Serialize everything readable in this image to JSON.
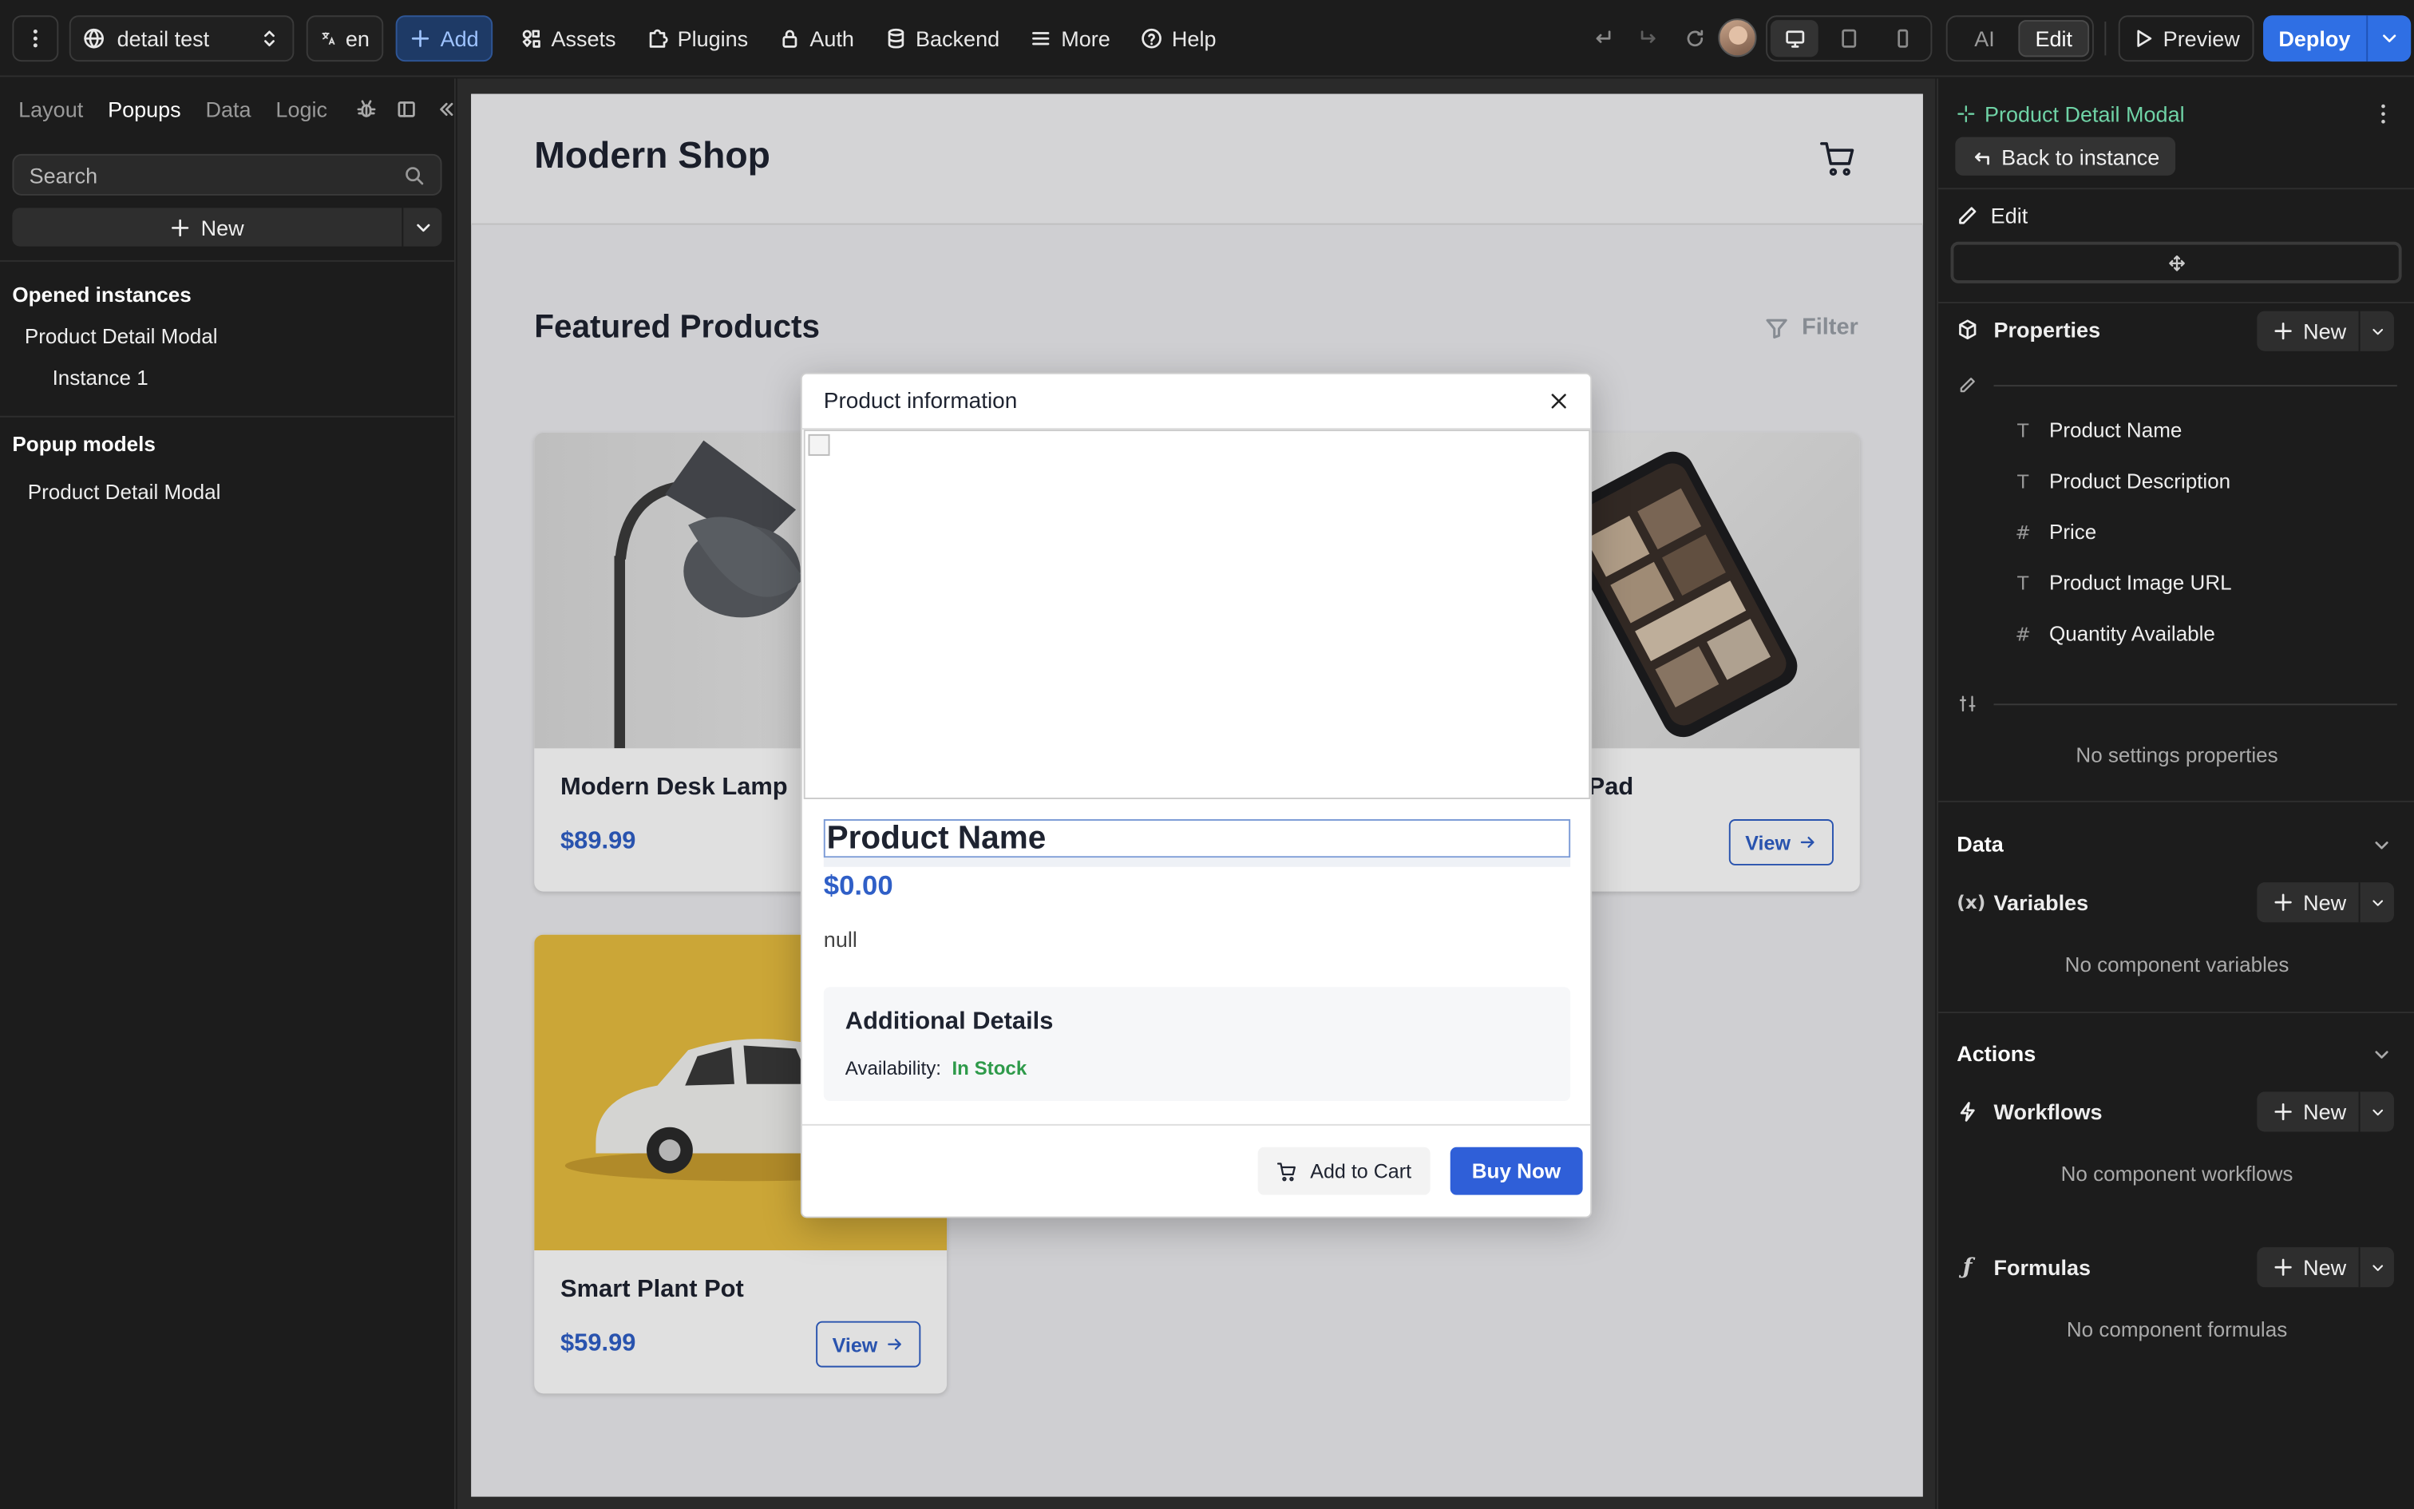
{
  "topbar": {
    "site_name": "detail test",
    "lang": "en",
    "add_label": "Add",
    "nav": [
      {
        "label": "Assets",
        "icon": "assets-icon"
      },
      {
        "label": "Plugins",
        "icon": "plugin-icon"
      },
      {
        "label": "Auth",
        "icon": "lock-icon"
      },
      {
        "label": "Backend",
        "icon": "database-icon"
      },
      {
        "label": "More",
        "icon": "menu-icon"
      },
      {
        "label": "Help",
        "icon": "help-icon"
      }
    ],
    "mode_ai": "AI",
    "mode_edit": "Edit",
    "preview_label": "Preview",
    "deploy_label": "Deploy"
  },
  "left": {
    "tabs": [
      "Layout",
      "Popups",
      "Data",
      "Logic"
    ],
    "active_tab": "Popups",
    "search_placeholder": "Search",
    "new_label": "New",
    "opened_title": "Opened instances",
    "opened_item": "Product Detail Modal",
    "opened_sub": "Instance 1",
    "models_title": "Popup models",
    "models_item": "Product Detail Modal"
  },
  "canvas": {
    "shop_title": "Modern Shop",
    "featured_title": "Featured Products",
    "filter_label": "Filter",
    "cards": [
      {
        "name": "Modern Desk Lamp",
        "price": "$89.99",
        "view": "View"
      },
      {
        "name": "Charging Pad",
        "price": "",
        "view": "View"
      },
      {
        "name": "Smart Plant Pot",
        "price": "$59.99",
        "view": "View"
      }
    ]
  },
  "modal": {
    "title": "Product information",
    "product_name": "Product Name",
    "price": "$0.00",
    "description": "null",
    "details_title": "Additional Details",
    "availability_label": "Availability:",
    "availability_value": "In Stock",
    "add_to_cart": "Add to Cart",
    "buy_now": "Buy Now"
  },
  "right": {
    "component_title": "Product Detail Modal",
    "back_label": "Back to instance",
    "edit_label": "Edit",
    "properties_label": "Properties",
    "new_label": "New",
    "properties": [
      {
        "type": "T",
        "label": "Product Name"
      },
      {
        "type": "T",
        "label": "Product Description"
      },
      {
        "type": "#",
        "label": "Price"
      },
      {
        "type": "T",
        "label": "Product Image URL"
      },
      {
        "type": "#",
        "label": "Quantity Available"
      }
    ],
    "no_settings": "No settings properties",
    "data_title": "Data",
    "variables_label": "Variables",
    "no_variables": "No component variables",
    "actions_title": "Actions",
    "workflows_label": "Workflows",
    "no_workflows": "No component workflows",
    "formulas_label": "Formulas",
    "no_formulas": "No component formulas"
  },
  "colors": {
    "accent_blue": "#2f6fe4",
    "price_blue": "#2f5fc7",
    "in_stock_green": "#2e9a4a",
    "component_green": "#6fd3a6"
  }
}
